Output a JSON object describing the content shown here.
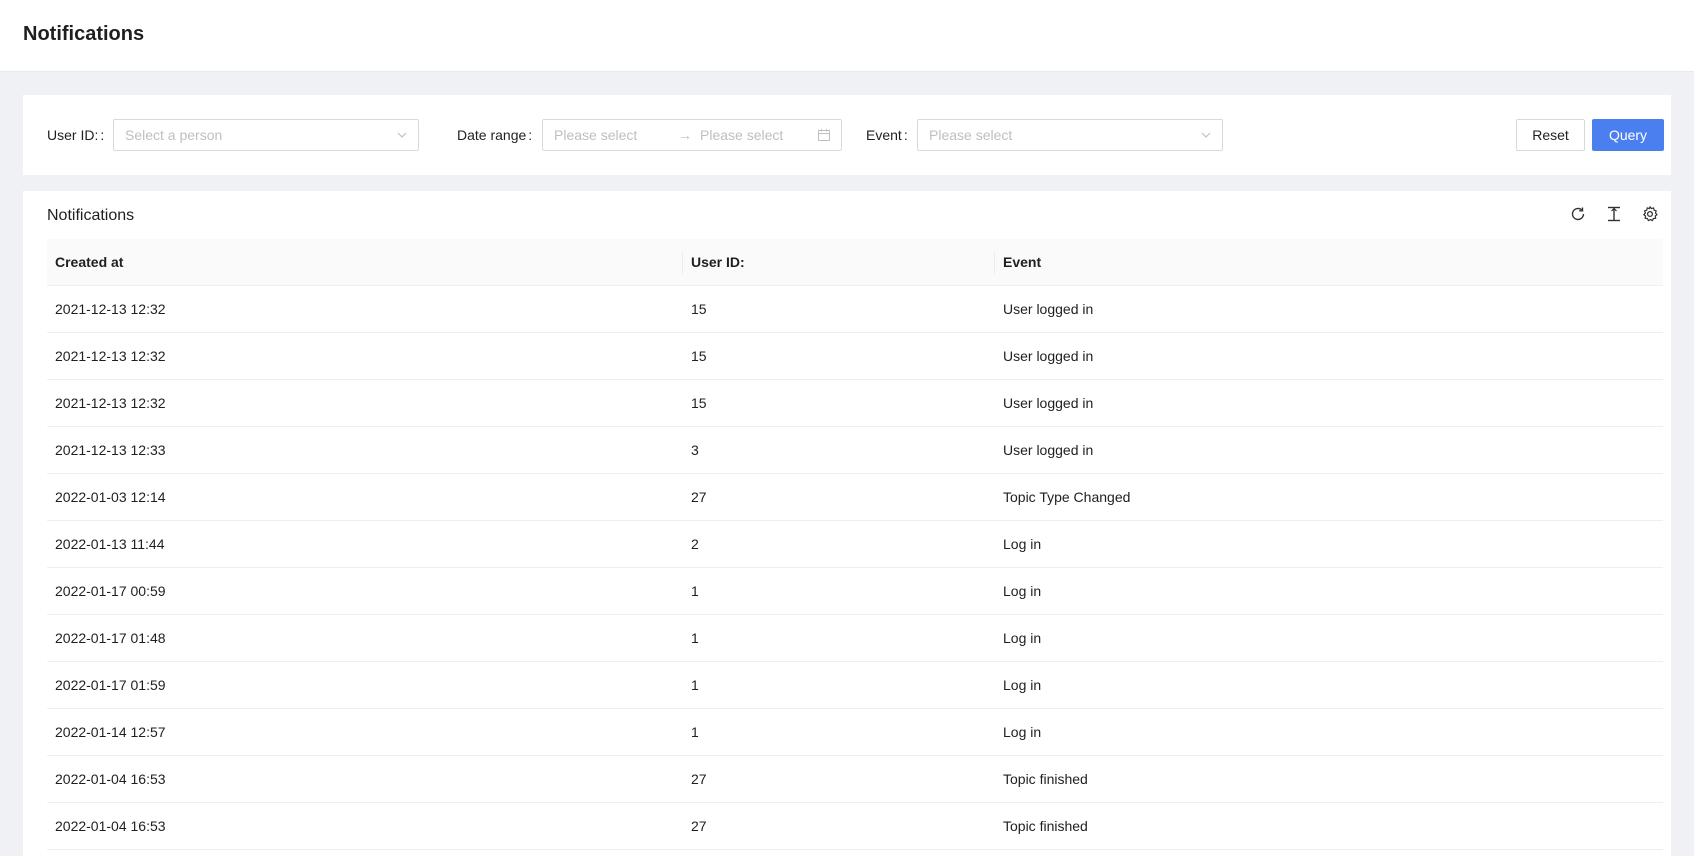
{
  "header": {
    "title": "Notifications"
  },
  "filters": {
    "user_label": "User ID:",
    "user_colon": ":",
    "user_placeholder": "Select a person",
    "date_label": "Date range",
    "date_colon": ":",
    "date_start_placeholder": "Please select",
    "date_arrow": "→",
    "date_end_placeholder": "Please select",
    "event_label": "Event",
    "event_colon": ":",
    "event_placeholder": "Please select",
    "reset_label": "Reset",
    "query_label": "Query"
  },
  "table": {
    "title": "Notifications",
    "toolbar_icons": [
      "refresh-icon",
      "column-height-icon",
      "settings-icon"
    ],
    "columns": [
      "Created at",
      "User ID:",
      "Event"
    ],
    "rows": [
      [
        "2021-12-13 12:32",
        "15",
        "User logged in"
      ],
      [
        "2021-12-13 12:32",
        "15",
        "User logged in"
      ],
      [
        "2021-12-13 12:32",
        "15",
        "User logged in"
      ],
      [
        "2021-12-13 12:33",
        "3",
        "User logged in"
      ],
      [
        "2022-01-03 12:14",
        "27",
        "Topic Type Changed"
      ],
      [
        "2022-01-13 11:44",
        "2",
        "Log in"
      ],
      [
        "2022-01-17 00:59",
        "1",
        "Log in"
      ],
      [
        "2022-01-17 01:48",
        "1",
        "Log in"
      ],
      [
        "2022-01-17 01:59",
        "1",
        "Log in"
      ],
      [
        "2022-01-14 12:57",
        "1",
        "Log in"
      ],
      [
        "2022-01-04 16:53",
        "27",
        "Topic finished"
      ],
      [
        "2022-01-04 16:53",
        "27",
        "Topic finished"
      ]
    ]
  },
  "colors": {
    "primary": "#4b7ff0",
    "background": "#f0f1f4"
  }
}
